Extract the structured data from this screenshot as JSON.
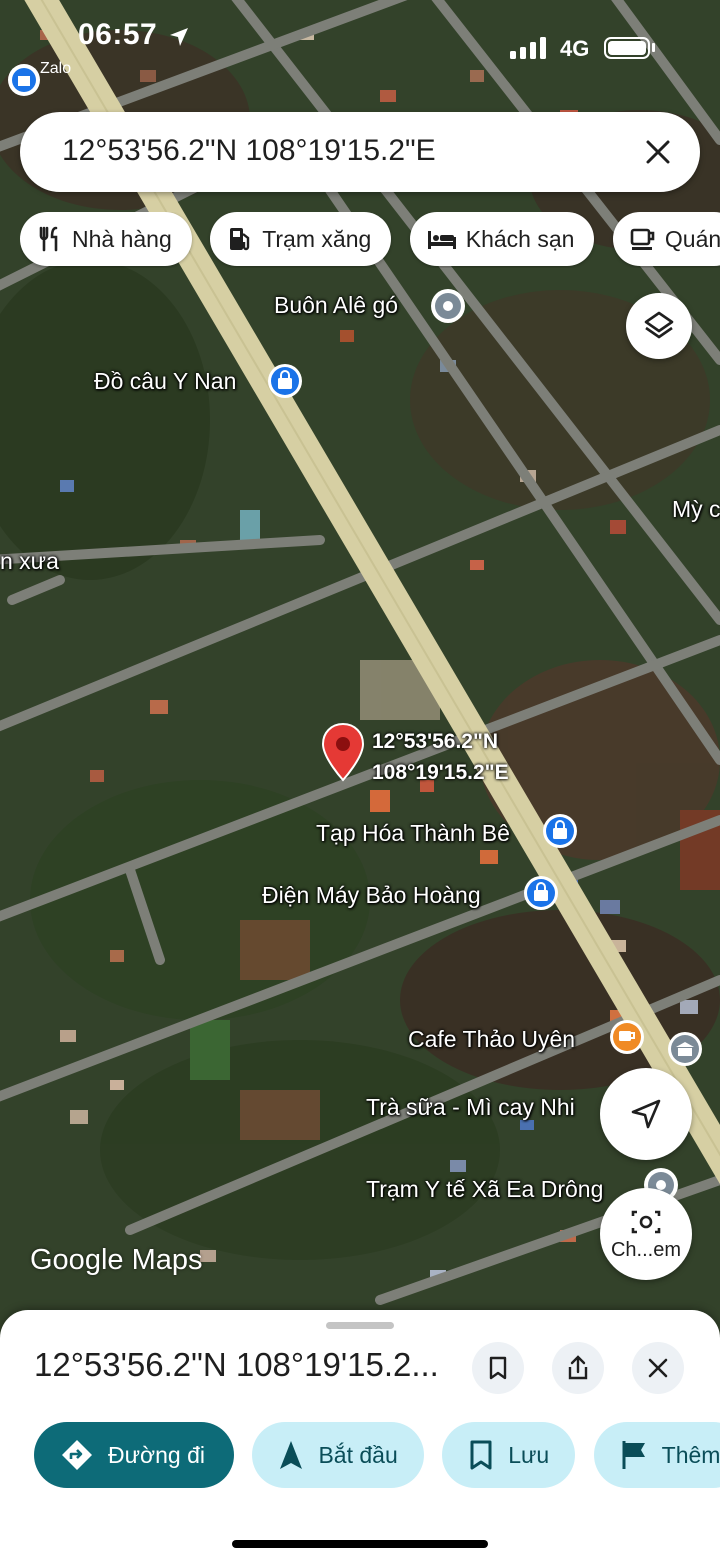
{
  "status_bar": {
    "time": "06:57",
    "back_app": "Zalo",
    "network": "4G"
  },
  "search": {
    "query": "12°53'56.2\"N 108°19'15.2\"E"
  },
  "categories": [
    {
      "label": "Nhà hàng",
      "icon": "restaurant-icon"
    },
    {
      "label": "Trạm xăng",
      "icon": "gas-station-icon"
    },
    {
      "label": "Khách sạn",
      "icon": "hotel-icon"
    },
    {
      "label": "Quán",
      "icon": "cafe-icon"
    }
  ],
  "map": {
    "pin_label_line1": "12°53'56.2\"N",
    "pin_label_line2": "108°19'15.2\"E",
    "pois": [
      {
        "name": "Buôn Alê gó",
        "icon": "place-icon"
      },
      {
        "name": "Đồ câu Y Nan",
        "icon": "shopping-bag-icon"
      },
      {
        "name": "Mỳ c",
        "icon": "none"
      },
      {
        "name": "n xưa",
        "icon": "none"
      },
      {
        "name": "Tạp Hóa Thành Bê",
        "icon": "shopping-bag-icon"
      },
      {
        "name": "Điện Máy Bảo Hoàng",
        "icon": "shopping-bag-icon"
      },
      {
        "name": "Cafe Thảo Uyên",
        "icon": "cafe-icon"
      },
      {
        "name": "Trà sữa - Mì cay Nhi",
        "icon": "none"
      },
      {
        "name": "Trạm Y tế Xã Ea Drông",
        "icon": "place-icon"
      }
    ],
    "watermark": "Google Maps",
    "lens_label": "Ch...em"
  },
  "sheet": {
    "title": "12°53'56.2\"N 108°19'15.2...",
    "actions": [
      {
        "label": "Đường đi",
        "icon": "directions-icon"
      },
      {
        "label": "Bắt đầu",
        "icon": "navigation-arrow-icon"
      },
      {
        "label": "Lưu",
        "icon": "bookmark-icon"
      },
      {
        "label": "Thêm",
        "icon": "flag-icon"
      }
    ]
  },
  "colors": {
    "primary_button": "#0d6b78",
    "secondary_button": "#c8eef7",
    "pin": "#e53935",
    "poi_blue": "#1a73e8",
    "poi_orange": "#f08a24"
  }
}
